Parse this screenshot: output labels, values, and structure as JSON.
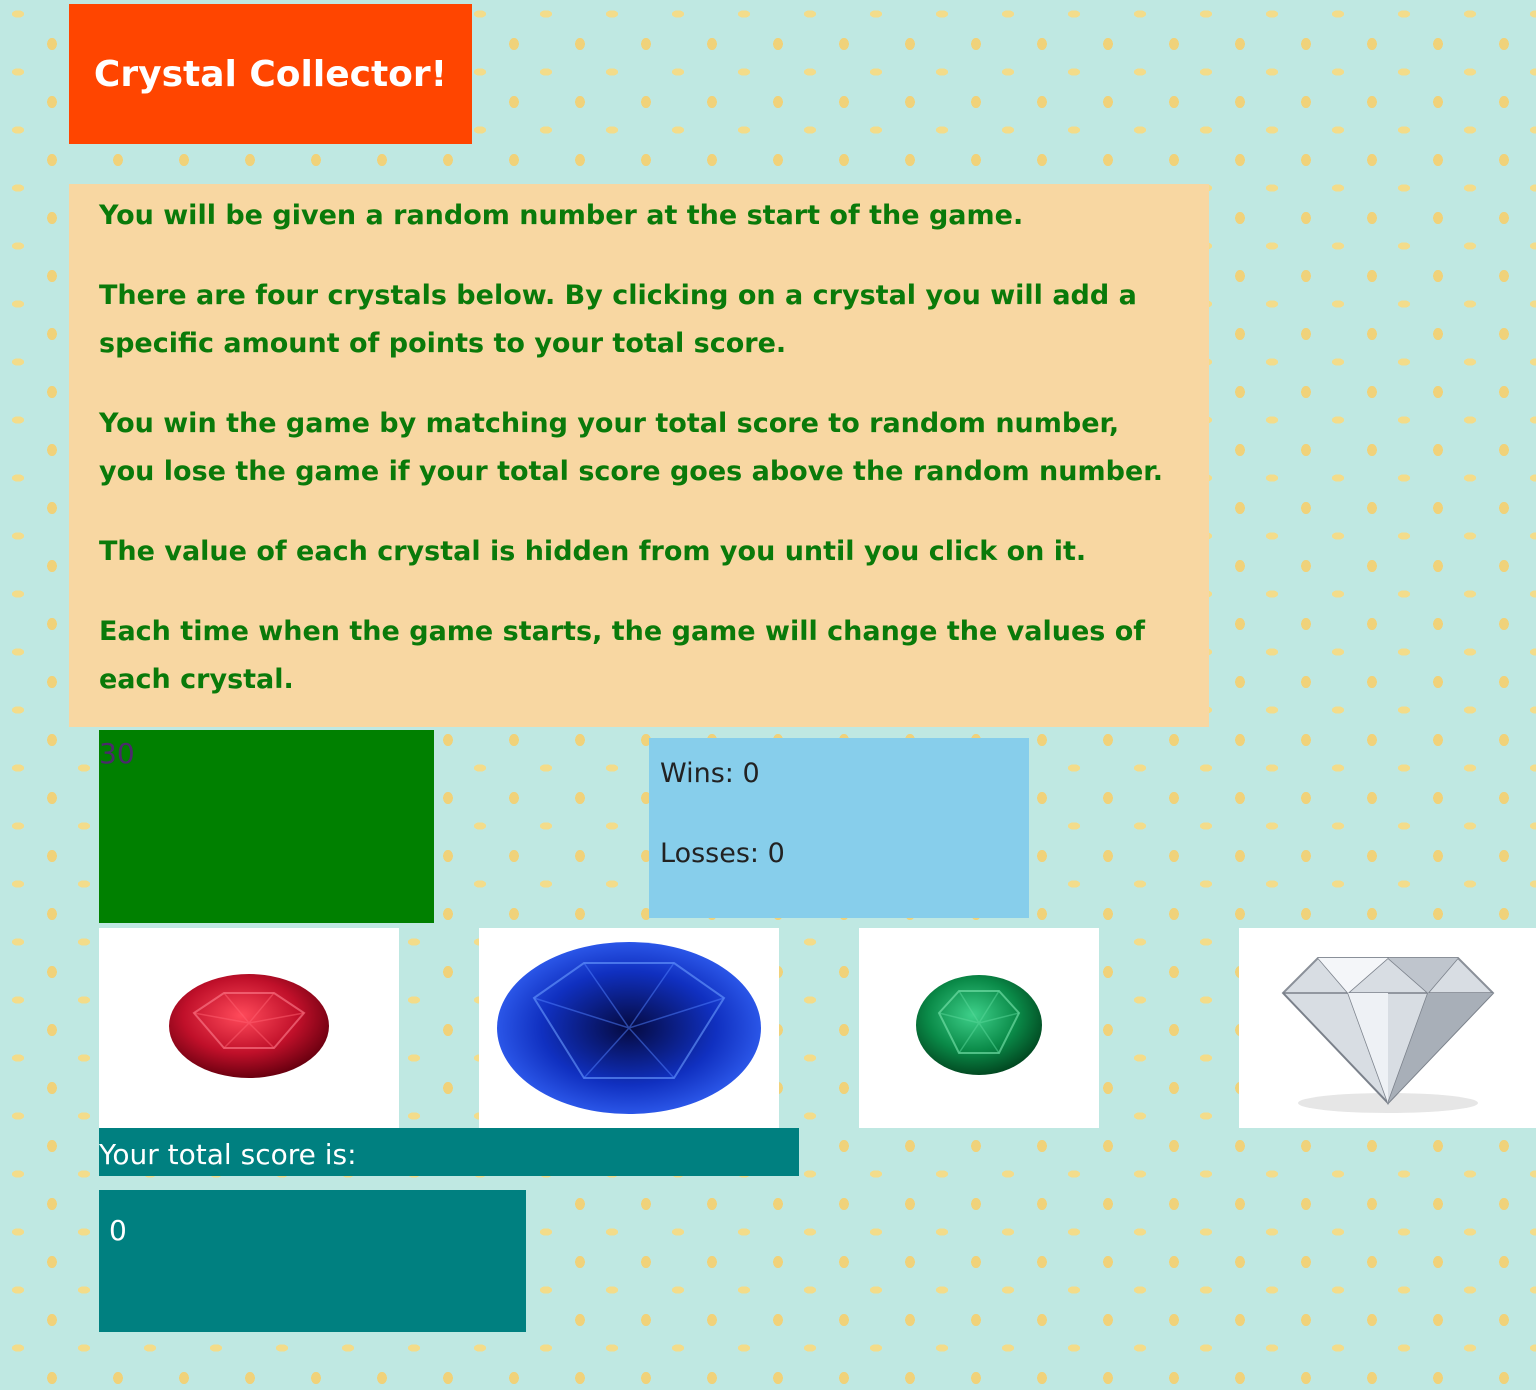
{
  "title": "Crystal Collector!",
  "instructions": [
    "You will be given a random number at the start of the game.",
    "There are four crystals below. By clicking on a crystal you will add a specific amount of points to your total score.",
    "You win the game by matching your total score to random number, you lose the game if your total score goes above the random number.",
    "The value of each crystal is hidden from you until you click on it.",
    "Each time when the game starts, the game will change the values of each crystal."
  ],
  "target_number": "30",
  "wins_label": "Wins: 0",
  "losses_label": "Losses: 0",
  "crystals": [
    "ruby-crystal-icon",
    "sapphire-crystal-icon",
    "emerald-crystal-icon",
    "diamond-crystal-icon"
  ],
  "score_label": "Your total score is:",
  "score_value": "0",
  "colors": {
    "title_bg": "#ff4500",
    "instructions_bg": "#f8d7a2",
    "instructions_text": "#0a7a0a",
    "target_bg": "#008000",
    "record_bg": "#87ceeb",
    "score_bg": "#008080"
  }
}
